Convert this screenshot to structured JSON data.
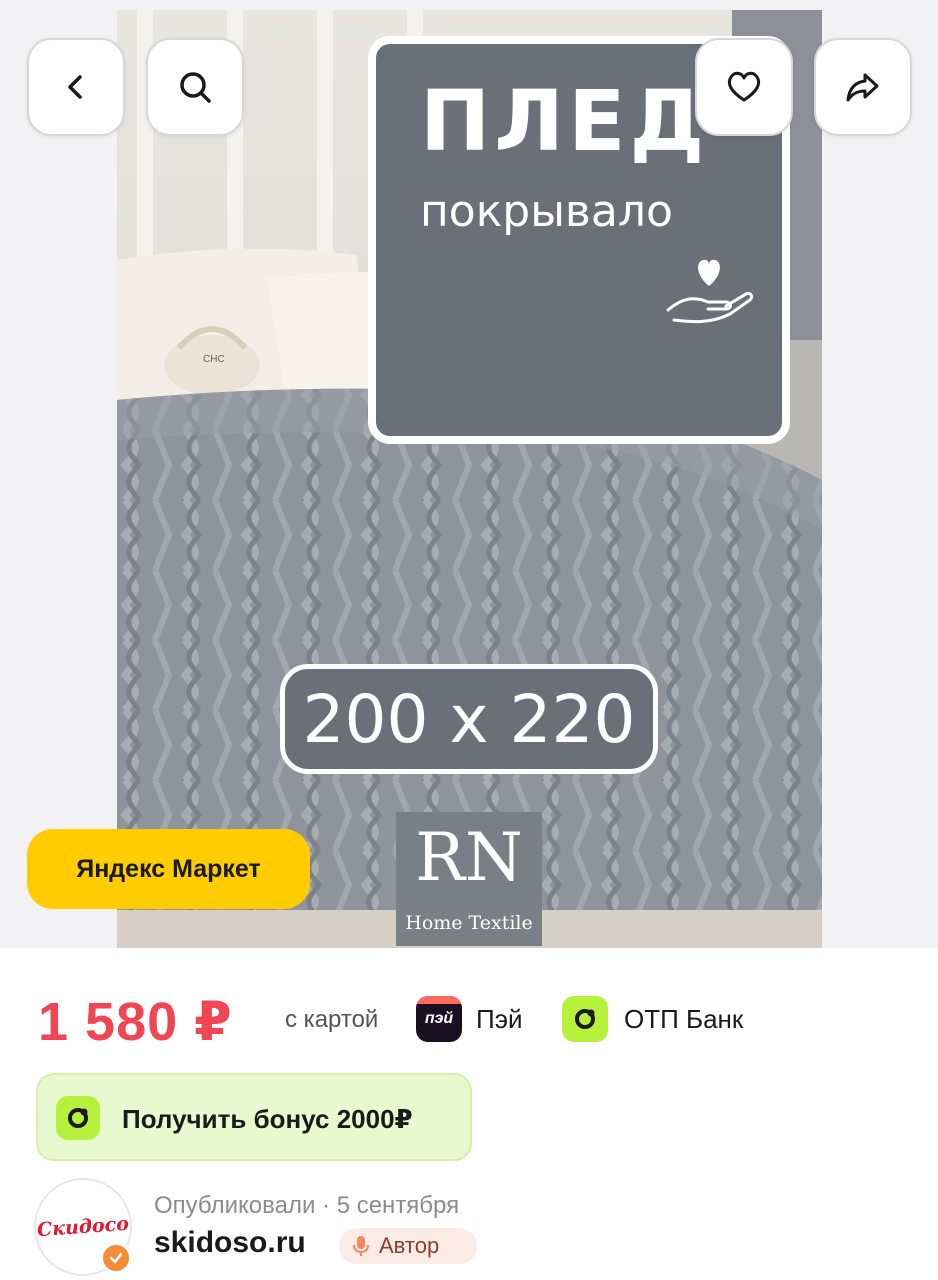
{
  "hero": {
    "headline_main": "ПЛЕД",
    "headline_sub": "покрывало",
    "size_text": "200 x 220",
    "brand_mark": "RN",
    "brand_sub": "Home Textile",
    "photo_lettering": "CHC",
    "store_badge": "Яндекс Маркет"
  },
  "nav": {
    "back_icon": "chevron-left-icon",
    "search_icon": "search-icon",
    "like_icon": "heart-icon",
    "share_icon": "share-arrow-icon"
  },
  "price": {
    "amount": "1 580 ₽",
    "with_card": "с картой",
    "pay_logo_text": "пэй",
    "pay_label": "Пэй",
    "bank_label": "ОТП Банк"
  },
  "bonus": {
    "label": "Получить бонус 2000₽"
  },
  "publisher": {
    "avatar_text": "Скидосо",
    "published": "Опубликовали · 5 сентября",
    "site": "skidoso.ru",
    "role": "Автор"
  },
  "colors": {
    "price": "#f04653",
    "store_badge": "#fecc00",
    "otp_green": "#b6f23c",
    "bonus_bg": "#e9f9cf",
    "author_chip": "#fdece6"
  }
}
